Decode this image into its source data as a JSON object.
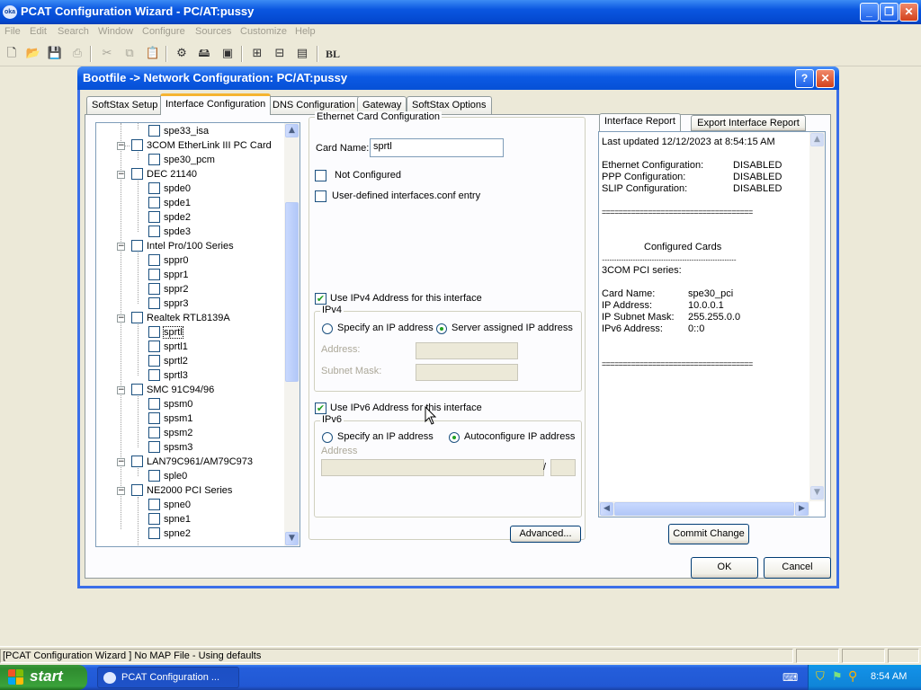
{
  "app": {
    "title": "PCAT Configuration Wizard  - PC/AT:pussy",
    "icon_text": "oka",
    "caption_buttons": {
      "minimize": "_",
      "maximize": "❐",
      "close": "✕"
    }
  },
  "menu": [
    "File",
    "Edit",
    "Search",
    "Window",
    "Configure",
    "Sources",
    "Customize",
    "Help"
  ],
  "toolbar": {
    "icons": [
      "new-icon",
      "open-icon",
      "save-icon",
      "print-icon",
      "cut-icon",
      "copy-icon",
      "paste-icon",
      "build-icon",
      "disk-icon",
      "transfer-icon",
      "network-icon",
      "save-all-icon",
      "bl-icon"
    ],
    "bl_label": "BL"
  },
  "dialog": {
    "title": "Bootfile -> Network Configuration: PC/AT:pussy",
    "help_button": "?",
    "close_button": "✕",
    "tabs": [
      "SoftStax Setup",
      "Interface Configuration",
      "DNS Configuration",
      "Gateway",
      "SoftStax Options"
    ],
    "active_tab": "Interface Configuration"
  },
  "tree": {
    "items": [
      "spe33_isa",
      "3COM EtherLink III PC Card",
      "spe30_pcm",
      "DEC 21140",
      "spde0",
      "spde1",
      "spde2",
      "spde3",
      "Intel Pro/100 Series",
      "sppr0",
      "sppr1",
      "sppr2",
      "sppr3",
      "Realtek RTL8139A",
      "sprtl",
      "sprtl1",
      "sprtl2",
      "sprtl3",
      "SMC 91C94/96",
      "spsm0",
      "spsm1",
      "spsm2",
      "spsm3",
      "LAN79C961/AM79C973",
      "sple0",
      "NE2000 PCI Series",
      "spne0",
      "spne1",
      "spne2"
    ]
  },
  "ethernet": {
    "group_label": "Ethernet Card Configuration",
    "card_name_label": "Card Name:",
    "card_name_value": "sprtl",
    "not_configured_label": "Not Configured",
    "user_defined_label": "User-defined interfaces.conf entry",
    "use_ipv4_label": "Use IPv4 Address for this interface",
    "ipv4_group": "IPv4",
    "ipv4_specify": "Specify an IP address",
    "ipv4_server": "Server assigned IP address",
    "address_label": "Address:",
    "subnet_label": "Subnet Mask:",
    "use_ipv6_label": "Use IPv6 Address for this interface",
    "ipv6_group": "IPv6",
    "ipv6_specify": "Specify an IP address",
    "ipv6_auto": "Autoconfigure IP address",
    "ipv6_address_label": "Address",
    "slash": "/",
    "advanced_button": "Advanced..."
  },
  "report": {
    "tab_label": "Interface Report",
    "export_button": "Export Interface Report",
    "last_updated": "Last updated 12/12/2023 at 8:54:15 AM",
    "config_rows": [
      {
        "label": "Ethernet Configuration:",
        "value": "DISABLED"
      },
      {
        "label": "PPP Configuration:",
        "value": "DISABLED"
      },
      {
        "label": "SLIP Configuration:",
        "value": "DISABLED"
      }
    ],
    "separator": "====================================",
    "configured_cards": "Configured Cards",
    "dotted": "............................................................................................",
    "series": "3COM PCI series:",
    "card_rows": [
      {
        "label": "Card Name:",
        "value": "spe30_pci"
      },
      {
        "label": "IP Address:",
        "value": "10.0.0.1"
      },
      {
        "label": "IP Subnet Mask:",
        "value": "255.255.0.0"
      },
      {
        "label": "IPv6 Address:",
        "value": "0::0"
      }
    ],
    "commit_button": "Commit Change"
  },
  "buttons": {
    "ok": "OK",
    "cancel": "Cancel"
  },
  "status": {
    "text": "[PCAT Configuration Wizard ] No MAP File - Using defaults"
  },
  "taskbar": {
    "start": "start",
    "item": "PCAT Configuration ...",
    "time": "8:54 AM"
  }
}
